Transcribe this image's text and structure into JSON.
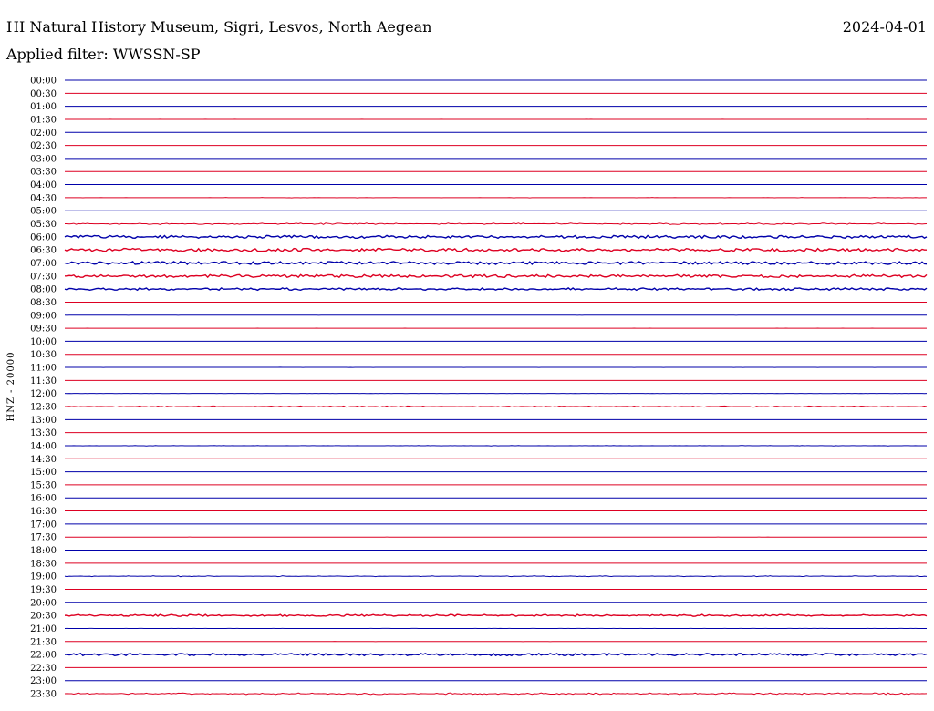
{
  "header": {
    "station": "HI Natural History Museum, Sigri, Lesvos, North Aegean",
    "date": "2024-04-01",
    "filter": "Applied filter: WWSSN-SP"
  },
  "chart_data": {
    "type": "line",
    "ylabel": "HNZ - 20000",
    "colors": {
      "even": "#0000aa",
      "odd": "#dd0022"
    },
    "rows": [
      {
        "label": "00:00",
        "activity": 0
      },
      {
        "label": "00:30",
        "activity": 0
      },
      {
        "label": "01:00",
        "activity": 0.03
      },
      {
        "label": "01:30",
        "activity": 0.05
      },
      {
        "label": "02:00",
        "activity": 0
      },
      {
        "label": "02:30",
        "activity": 0
      },
      {
        "label": "03:00",
        "activity": 0
      },
      {
        "label": "03:30",
        "activity": 0
      },
      {
        "label": "04:00",
        "activity": 0
      },
      {
        "label": "04:30",
        "activity": 0.15
      },
      {
        "label": "05:00",
        "activity": 0
      },
      {
        "label": "05:30",
        "activity": 0.45
      },
      {
        "label": "06:00",
        "activity": 0.85
      },
      {
        "label": "06:30",
        "activity": 0.9
      },
      {
        "label": "07:00",
        "activity": 0.9
      },
      {
        "label": "07:30",
        "activity": 0.85
      },
      {
        "label": "08:00",
        "activity": 0.7
      },
      {
        "label": "08:30",
        "activity": 0
      },
      {
        "label": "09:00",
        "activity": 0.05
      },
      {
        "label": "09:30",
        "activity": 0.05
      },
      {
        "label": "10:00",
        "activity": 0
      },
      {
        "label": "10:30",
        "activity": 0
      },
      {
        "label": "11:00",
        "activity": 0.08
      },
      {
        "label": "11:30",
        "activity": 0
      },
      {
        "label": "12:00",
        "activity": 0.05
      },
      {
        "label": "12:30",
        "activity": 0.35
      },
      {
        "label": "13:00",
        "activity": 0
      },
      {
        "label": "13:30",
        "activity": 0
      },
      {
        "label": "14:00",
        "activity": 0.15
      },
      {
        "label": "14:30",
        "activity": 0
      },
      {
        "label": "15:00",
        "activity": 0
      },
      {
        "label": "15:30",
        "activity": 0
      },
      {
        "label": "16:00",
        "activity": 0.02
      },
      {
        "label": "16:30",
        "activity": 0
      },
      {
        "label": "17:00",
        "activity": 0
      },
      {
        "label": "17:30",
        "activity": 0.03
      },
      {
        "label": "18:00",
        "activity": 0
      },
      {
        "label": "18:30",
        "activity": 0
      },
      {
        "label": "19:00",
        "activity": 0.3
      },
      {
        "label": "19:30",
        "activity": 0
      },
      {
        "label": "20:00",
        "activity": 0
      },
      {
        "label": "20:30",
        "activity": 0.6
      },
      {
        "label": "21:00",
        "activity": 0.03
      },
      {
        "label": "21:30",
        "activity": 0.05
      },
      {
        "label": "22:00",
        "activity": 0.7
      },
      {
        "label": "22:30",
        "activity": 0
      },
      {
        "label": "23:00",
        "activity": 0
      },
      {
        "label": "23:30",
        "activity": 0.5
      }
    ]
  }
}
